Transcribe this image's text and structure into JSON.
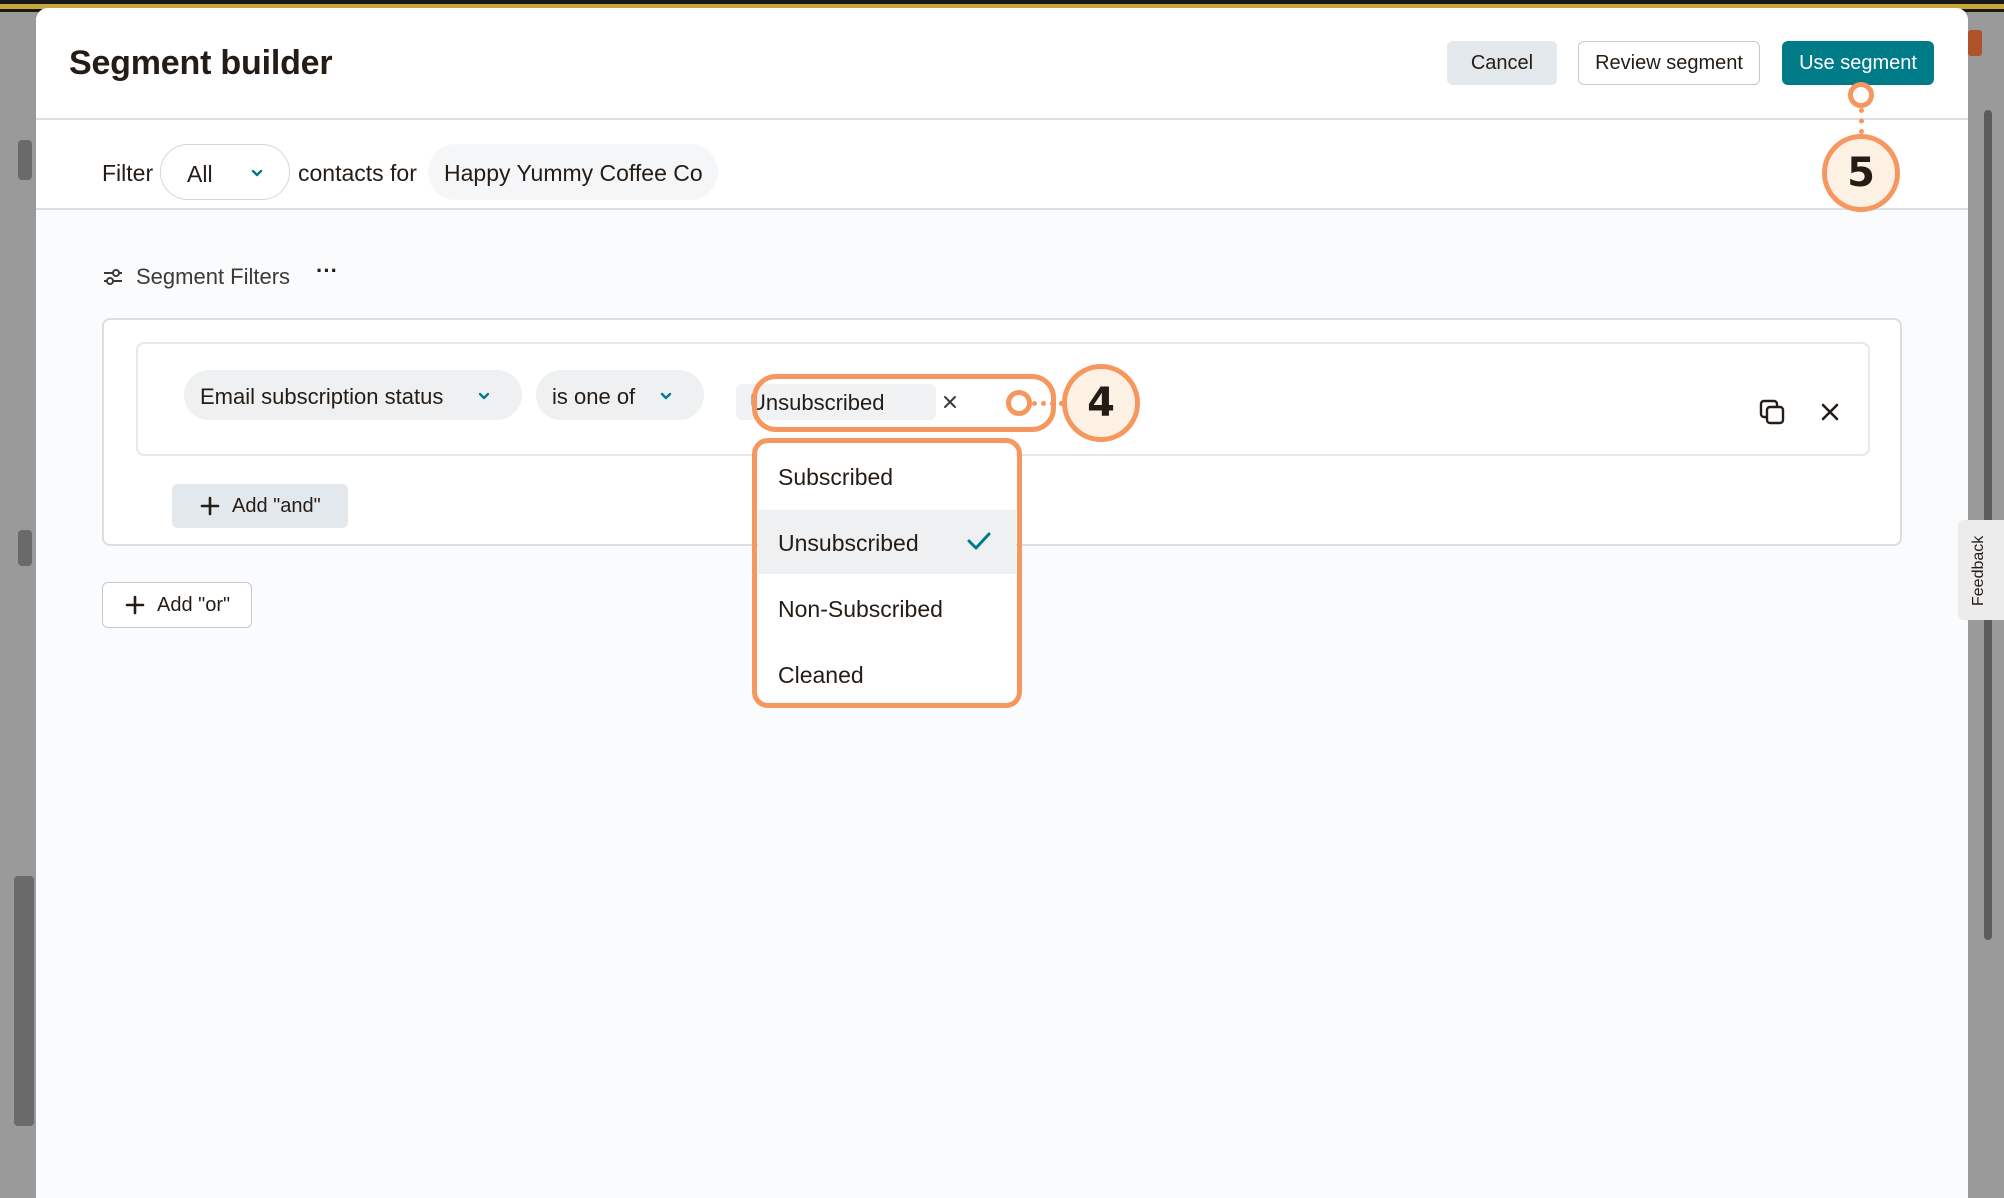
{
  "modal": {
    "title": "Segment builder",
    "cancel_label": "Cancel",
    "review_label": "Review segment",
    "use_label": "Use segment"
  },
  "filter_bar": {
    "filter_label": "Filter",
    "match_value": "All",
    "contacts_for_label": "contacts for",
    "audience_name": "Happy Yummy Coffee Co"
  },
  "segment": {
    "label": "Segment Filters",
    "more_label": "···",
    "condition": {
      "field": "Email subscription status",
      "operator": "is one of",
      "selected_tags": [
        "Unsubscribed"
      ]
    },
    "dropdown_options": [
      {
        "label": "Subscribed",
        "selected": false
      },
      {
        "label": "Unsubscribed",
        "selected": true
      },
      {
        "label": "Non-Subscribed",
        "selected": false
      },
      {
        "label": "Cleaned",
        "selected": false
      }
    ],
    "add_and_label": "Add \"and\"",
    "add_or_label": "Add \"or\""
  },
  "callouts": {
    "step4": "4",
    "step5": "5"
  },
  "feedback_label": "Feedback",
  "colors": {
    "primary": "#007c89",
    "highlight": "#f6975f",
    "badge_fill": "#fdf1e4"
  }
}
